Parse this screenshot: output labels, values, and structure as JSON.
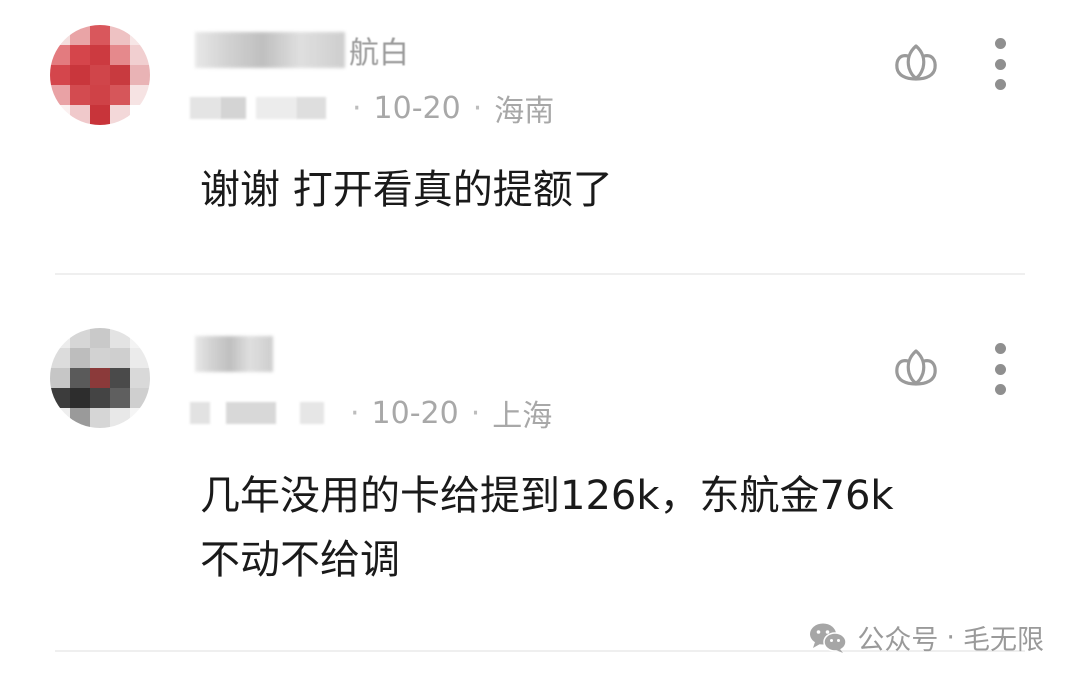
{
  "comments": [
    {
      "username_tail": "航白",
      "meta": {
        "date": "10-20",
        "location": "海南"
      },
      "text": "谢谢 打开看真的提额了"
    },
    {
      "username_tail": "",
      "meta": {
        "date": "10-20",
        "location": "上海"
      },
      "text_line1": "几年没用的卡给提到126k，东航金76k",
      "text_line2": "不动不给调"
    }
  ],
  "meta_separator": "·",
  "watermark": {
    "label": "公众号",
    "separator": "·",
    "account": "毛无限"
  },
  "icons": {
    "like": "lotus-like-icon",
    "more": "more-vertical-icon",
    "wechat": "wechat-icon"
  },
  "colors": {
    "text": "#1a1a1a",
    "meta": "#a8a8a8",
    "divider": "#efefef",
    "avatar1": "#d9494f"
  }
}
